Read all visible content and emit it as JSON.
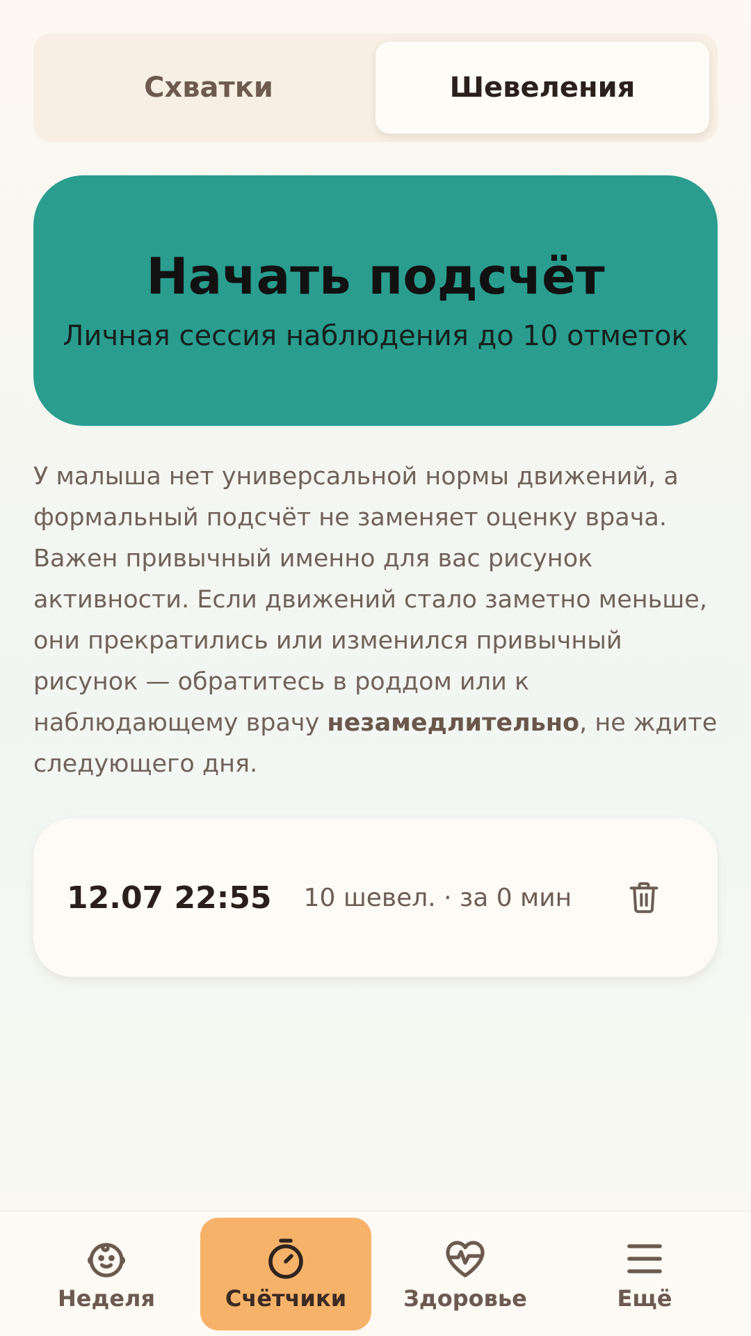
{
  "tabs": {
    "contractions_label": "Схватки",
    "movements_label": "Шевеления",
    "active": "movements"
  },
  "start": {
    "title": "Начать подсчёт",
    "subtitle": "Личная сессия наблюдения до 10 отметок"
  },
  "info": {
    "text_before": "У малыша нет универсальной нормы движений, а формальный подсчёт не заменяет оценку врача. Важен привычный именно для вас рисунок активности. Если движений стало заметно меньше, они прекратились или изменился привычный рисунок — обратитесь в роддом или к наблюдающему врачу ",
    "emphasis": "незамедлительно",
    "text_after": ", не ждите следующего дня."
  },
  "sessions": [
    {
      "time": "12.07 22:55",
      "summary": "10 шевел. · за 0 мин",
      "icon": "trash-icon"
    }
  ],
  "nav": {
    "items": [
      {
        "label": "Неделя",
        "icon": "baby-face-icon"
      },
      {
        "label": "Счётчики",
        "icon": "stopwatch-icon",
        "active": true
      },
      {
        "label": "Здоровье",
        "icon": "heart-pulse-icon"
      },
      {
        "label": "Ещё",
        "icon": "menu-icon"
      }
    ]
  },
  "colors": {
    "accent_teal": "#2a9d8f",
    "nav_active": "#f7b26a",
    "text_brown": "#6c5a50"
  }
}
